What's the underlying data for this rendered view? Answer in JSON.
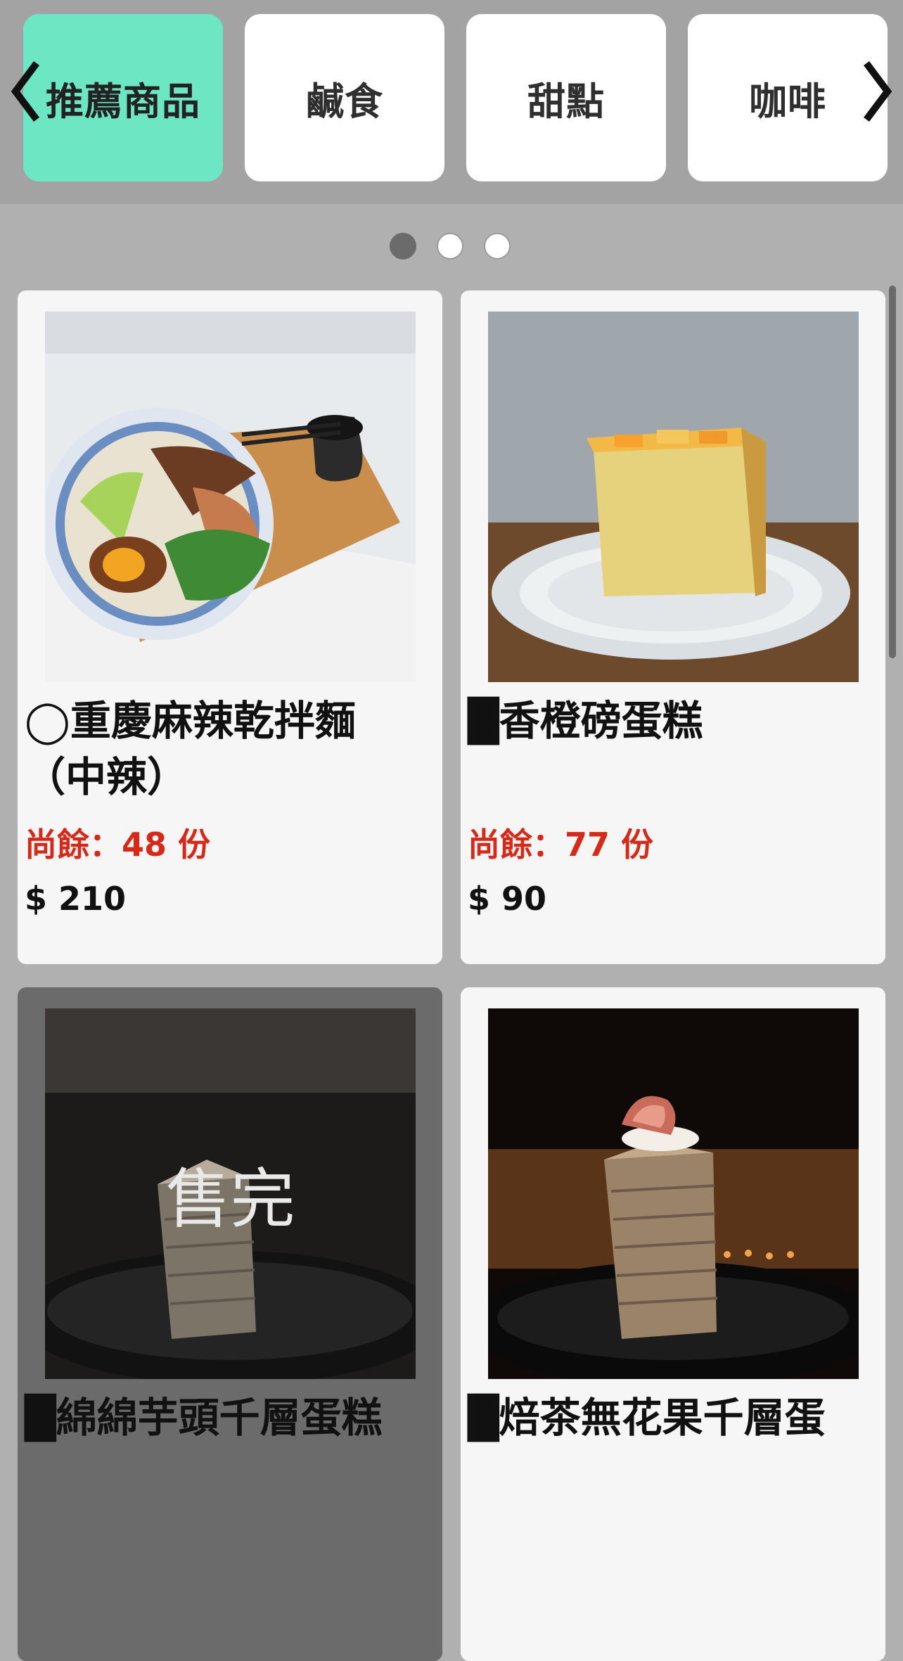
{
  "tabs": [
    {
      "label": "推薦商品",
      "active": true
    },
    {
      "label": "鹹食",
      "active": false
    },
    {
      "label": "甜點",
      "active": false
    },
    {
      "label": "咖啡",
      "active": false
    }
  ],
  "pagination": {
    "pages": 3,
    "current": 1
  },
  "products": [
    {
      "name": "◯重慶麻辣乾拌麵（中辣）",
      "remaining": "尚餘：48 份",
      "price": "$ 210",
      "sold_out": false
    },
    {
      "name": "█香橙磅蛋糕",
      "remaining": "尚餘：77 份",
      "price": "$ 90",
      "sold_out": false
    },
    {
      "name": "█綿綿芋頭千層蛋糕",
      "sold_out_label": "售完",
      "sold_out": true
    },
    {
      "name": "█焙茶無花果千層蛋",
      "sold_out": false
    }
  ],
  "colors": {
    "active_tab": "#6de7c3",
    "remaining_text": "#d52a1a",
    "topbar": "#a3a3a3"
  }
}
